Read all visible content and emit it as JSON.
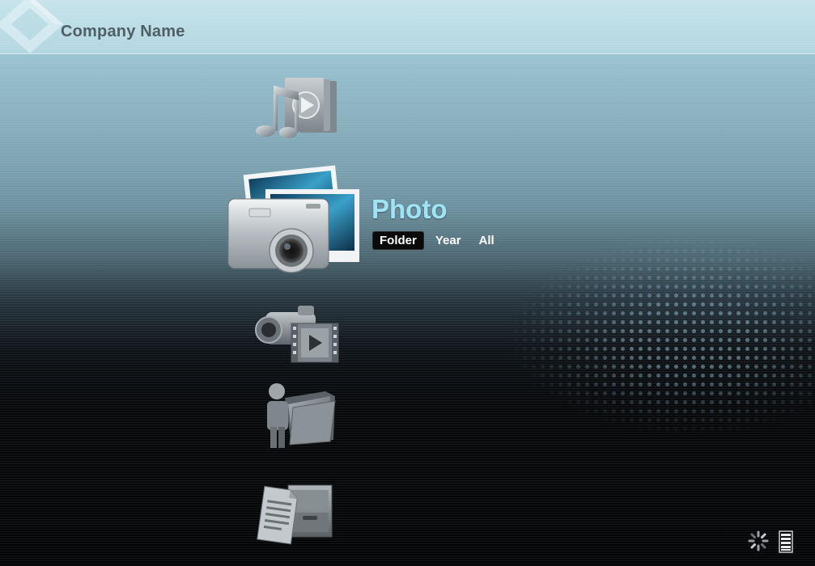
{
  "header": {
    "company_name": "Company Name",
    "logo": "diamond-logo"
  },
  "menu": {
    "items": [
      {
        "id": "music-video",
        "icon": "music-media-icon",
        "selected": false
      },
      {
        "id": "photo",
        "icon": "camera-photo-icon",
        "selected": true,
        "title": "Photo",
        "subtabs": [
          {
            "label": "Folder",
            "active": true
          },
          {
            "label": "Year",
            "active": false
          },
          {
            "label": "All",
            "active": false
          }
        ]
      },
      {
        "id": "video",
        "icon": "camcorder-film-icon",
        "selected": false
      },
      {
        "id": "user-folder",
        "icon": "user-folder-icon",
        "selected": false
      },
      {
        "id": "documents",
        "icon": "document-cabinet-icon",
        "selected": false
      }
    ]
  },
  "status_bar": {
    "icons": [
      "loading-spinner-icon",
      "battery-icon"
    ]
  },
  "colors": {
    "accent_title": "#9fe3f6",
    "active_tab_bg": "#0a0a0a"
  }
}
